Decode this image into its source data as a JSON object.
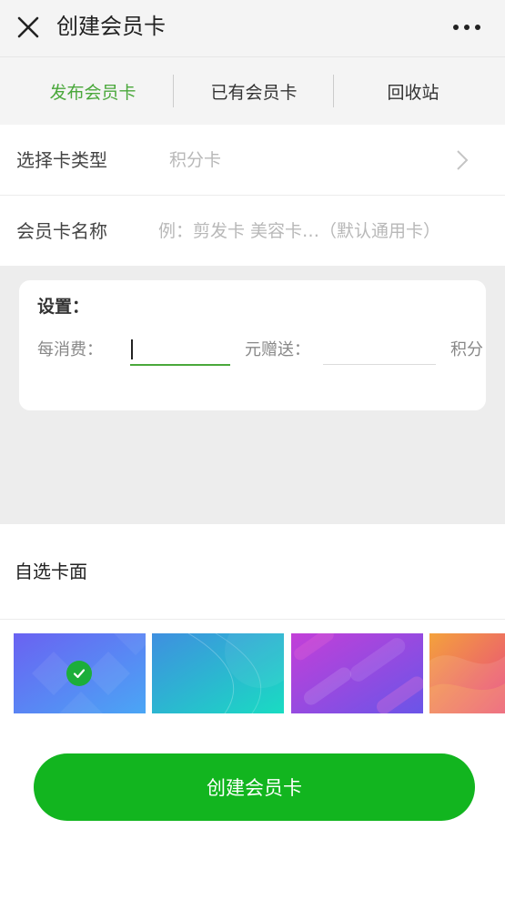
{
  "header": {
    "title": "创建会员卡"
  },
  "tabs": [
    {
      "label": "发布会员卡"
    },
    {
      "label": "已有会员卡"
    },
    {
      "label": "回收站"
    }
  ],
  "form": {
    "card_type_label": "选择卡类型",
    "card_type_value": "积分卡",
    "card_name_label": "会员卡名称",
    "card_name_placeholder": "例：剪发卡 美容卡…（默认通用卡）",
    "card_name_value": ""
  },
  "settings": {
    "title": "设置：",
    "spend_label": "每消费：",
    "spend_value": "",
    "gift_label": "元赠送：",
    "gift_value": "",
    "points_unit": "积分"
  },
  "card_faces": {
    "title": "自选卡面",
    "selected_index": 0
  },
  "create_button": {
    "label": "创建会员卡"
  },
  "colors": {
    "accent": "#4aa83b",
    "button": "#12b51f",
    "check": "#1cae3a"
  }
}
